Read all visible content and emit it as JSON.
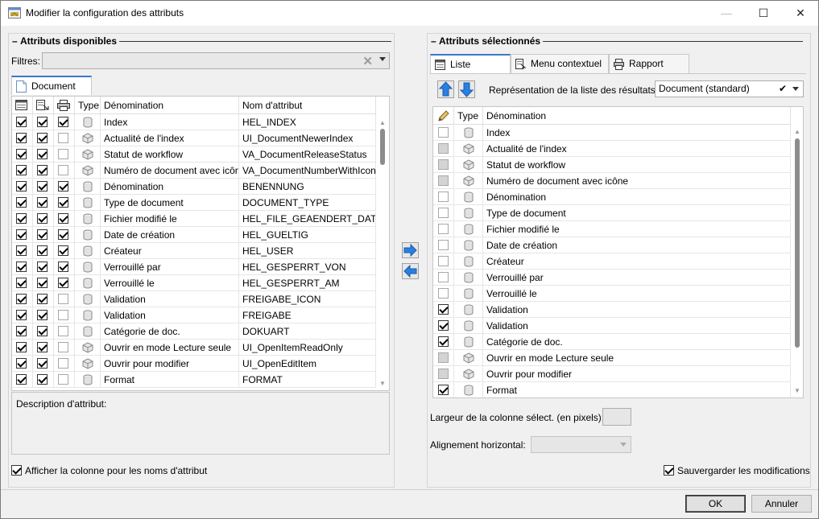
{
  "window": {
    "title": "Modifier la configuration des attributs",
    "minimize": "—",
    "maximize": "☐",
    "close": "✕"
  },
  "colors": {
    "accent": "#3c78c8",
    "arrow_blue": "#2b7fe0"
  },
  "left": {
    "group_title": "Attributs disponibles",
    "filter_label": "Filtres:",
    "filter_value": "",
    "tab_label": "Document",
    "columns": {
      "type": "Type",
      "name": "Dénomination",
      "attr": "Nom d'attribut"
    },
    "rows": [
      {
        "c1": true,
        "c2": true,
        "c3": true,
        "icon": "cylinder",
        "name": "Index",
        "attr": "HEL_INDEX"
      },
      {
        "c1": true,
        "c2": true,
        "c3": false,
        "icon": "cube",
        "name": "Actualité de l'index",
        "attr": "UI_DocumentNewerIndex"
      },
      {
        "c1": true,
        "c2": true,
        "c3": false,
        "icon": "cube",
        "name": "Statut de workflow",
        "attr": "VA_DocumentReleaseStatus"
      },
      {
        "c1": true,
        "c2": true,
        "c3": false,
        "icon": "cube",
        "name": "Numéro de document avec icône",
        "attr": "VA_DocumentNumberWithIcon"
      },
      {
        "c1": true,
        "c2": true,
        "c3": true,
        "icon": "cylinder",
        "name": "Dénomination",
        "attr": "BENENNUNG"
      },
      {
        "c1": true,
        "c2": true,
        "c3": true,
        "icon": "cylinder",
        "name": "Type de document",
        "attr": "DOCUMENT_TYPE"
      },
      {
        "c1": true,
        "c2": true,
        "c3": true,
        "icon": "cylinder",
        "name": "Fichier modifié le",
        "attr": "HEL_FILE_GEAENDERT_DATUM"
      },
      {
        "c1": true,
        "c2": true,
        "c3": true,
        "icon": "cylinder",
        "name": "Date de création",
        "attr": "HEL_GUELTIG"
      },
      {
        "c1": true,
        "c2": true,
        "c3": true,
        "icon": "cylinder",
        "name": "Créateur",
        "attr": "HEL_USER"
      },
      {
        "c1": true,
        "c2": true,
        "c3": true,
        "icon": "cylinder",
        "name": "Verrouillé par",
        "attr": "HEL_GESPERRT_VON"
      },
      {
        "c1": true,
        "c2": true,
        "c3": true,
        "icon": "cylinder",
        "name": "Verrouillé le",
        "attr": "HEL_GESPERRT_AM"
      },
      {
        "c1": true,
        "c2": true,
        "c3": false,
        "icon": "cylinder",
        "name": "Validation",
        "attr": "FREIGABE_ICON"
      },
      {
        "c1": true,
        "c2": true,
        "c3": false,
        "icon": "cylinder",
        "name": "Validation",
        "attr": "FREIGABE"
      },
      {
        "c1": true,
        "c2": true,
        "c3": false,
        "icon": "cylinder",
        "name": "Catégorie de doc.",
        "attr": "DOKUART"
      },
      {
        "c1": true,
        "c2": true,
        "c3": false,
        "icon": "cube",
        "name": "Ouvrir en mode Lecture seule",
        "attr": "UI_OpenItemReadOnly"
      },
      {
        "c1": true,
        "c2": true,
        "c3": false,
        "icon": "cube",
        "name": "Ouvrir pour modifier",
        "attr": "UI_OpenEditItem"
      },
      {
        "c1": true,
        "c2": true,
        "c3": false,
        "icon": "cylinder",
        "name": "Format",
        "attr": "FORMAT"
      }
    ],
    "description_label": "Description d'attribut:",
    "show_column_label": "Afficher la colonne pour les noms d'attribut",
    "show_column_checked": true
  },
  "right": {
    "group_title": "Attributs sélectionnés",
    "tabs": [
      {
        "label": "Liste",
        "icon": "list-icon",
        "active": true
      },
      {
        "label": "Menu contextuel",
        "icon": "context-menu-icon",
        "active": false
      },
      {
        "label": "Rapport",
        "icon": "report-icon",
        "active": false
      }
    ],
    "representation_label": "Représentation de la liste des résultats:",
    "representation_value": "Document (standard)",
    "columns": {
      "type": "Type",
      "name": "Dénomination"
    },
    "rows": [
      {
        "state": "empty",
        "icon": "cylinder",
        "name": "Index"
      },
      {
        "state": "gray",
        "icon": "cube",
        "name": "Actualité de l'index"
      },
      {
        "state": "gray",
        "icon": "cube",
        "name": "Statut de workflow"
      },
      {
        "state": "gray",
        "icon": "cube",
        "name": "Numéro de document avec icône"
      },
      {
        "state": "empty",
        "icon": "cylinder",
        "name": "Dénomination"
      },
      {
        "state": "empty",
        "icon": "cylinder",
        "name": "Type de document"
      },
      {
        "state": "empty",
        "icon": "cylinder",
        "name": "Fichier modifié le"
      },
      {
        "state": "empty",
        "icon": "cylinder",
        "name": "Date de création"
      },
      {
        "state": "empty",
        "icon": "cylinder",
        "name": "Créateur"
      },
      {
        "state": "empty",
        "icon": "cylinder",
        "name": "Verrouillé par"
      },
      {
        "state": "empty",
        "icon": "cylinder",
        "name": "Verrouillé le"
      },
      {
        "state": "checked",
        "icon": "cylinder",
        "name": "Validation"
      },
      {
        "state": "checked",
        "icon": "cylinder",
        "name": "Validation"
      },
      {
        "state": "checked",
        "icon": "cylinder",
        "name": "Catégorie de doc."
      },
      {
        "state": "gray",
        "icon": "cube",
        "name": "Ouvrir en mode Lecture seule"
      },
      {
        "state": "gray",
        "icon": "cube",
        "name": "Ouvrir pour modifier"
      },
      {
        "state": "checked",
        "icon": "cylinder",
        "name": "Format"
      }
    ],
    "width_label": "Largeur de la colonne sélect. (en pixels):",
    "width_value": "",
    "align_label": "Alignement horizontal:",
    "align_value": "",
    "save_label": "Sauvergarder les modifications",
    "save_checked": true
  },
  "buttons": {
    "ok": "OK",
    "cancel": "Annuler"
  }
}
